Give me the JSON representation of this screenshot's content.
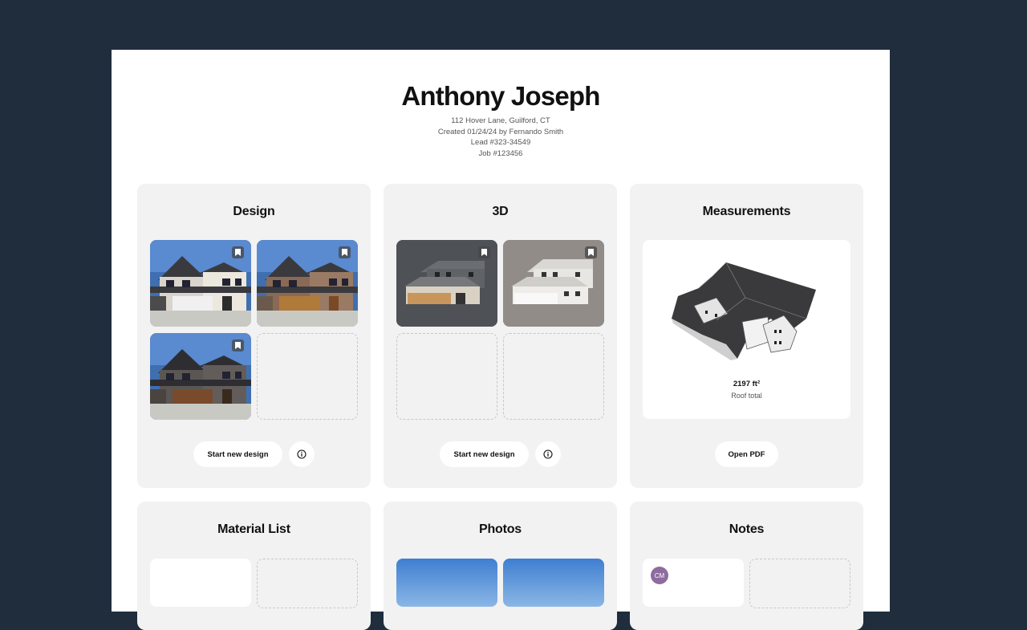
{
  "customer": {
    "name": "Anthony Joseph",
    "address": "112 Hover Lane, Guilford, CT",
    "created": "Created 01/24/24 by Fernando Smith",
    "lead": "Lead #323-34549",
    "job": "Job #123456"
  },
  "cards": {
    "design": {
      "title": "Design",
      "primary_button": "Start new design"
    },
    "three_d": {
      "title": "3D",
      "primary_button": "Start new design"
    },
    "measurements": {
      "title": "Measurements",
      "area": "2197 ft²",
      "area_label": "Roof total",
      "button": "Open PDF"
    },
    "material_list": {
      "title": "Material List"
    },
    "photos": {
      "title": "Photos"
    },
    "notes": {
      "title": "Notes",
      "avatar_initials": "CM"
    }
  },
  "colors": {
    "backdrop": "#1f2d3d",
    "card": "#f2f2f2",
    "avatar": "#8e6c9e"
  },
  "icons": [
    "bookmark-icon",
    "info-icon"
  ]
}
